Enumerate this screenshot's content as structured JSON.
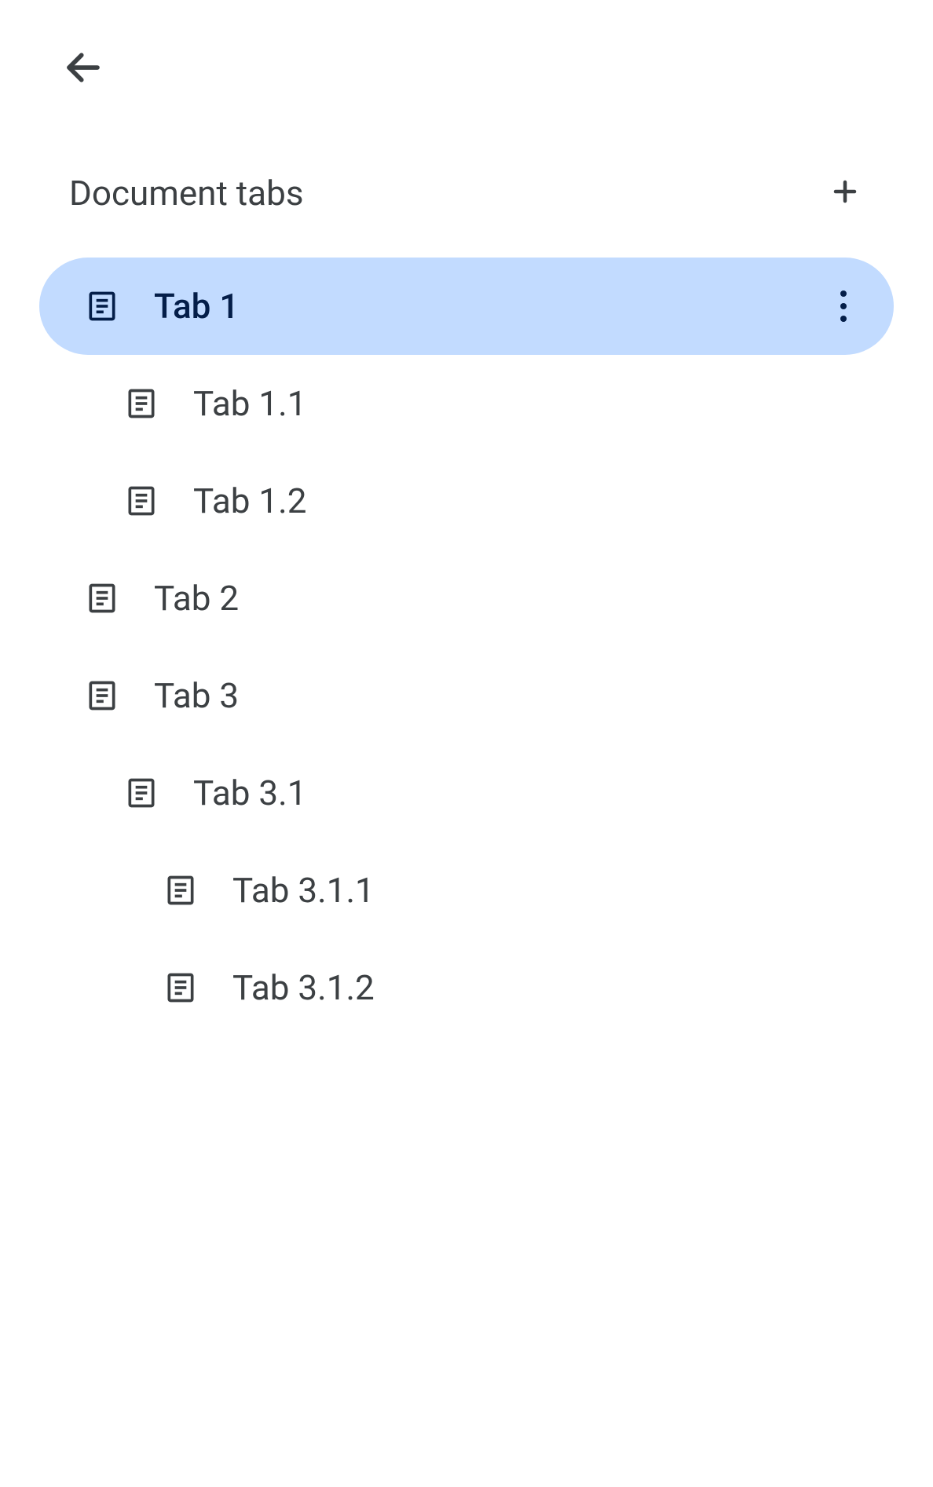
{
  "header": {
    "title": "Document tabs"
  },
  "tabs": [
    {
      "label": "Tab 1",
      "level": 0,
      "selected": true
    },
    {
      "label": "Tab 1.1",
      "level": 1,
      "selected": false
    },
    {
      "label": "Tab 1.2",
      "level": 1,
      "selected": false
    },
    {
      "label": "Tab 2",
      "level": 0,
      "selected": false
    },
    {
      "label": "Tab 3",
      "level": 0,
      "selected": false
    },
    {
      "label": "Tab 3.1",
      "level": 1,
      "selected": false
    },
    {
      "label": "Tab 3.1.1",
      "level": 2,
      "selected": false
    },
    {
      "label": "Tab 3.1.2",
      "level": 2,
      "selected": false
    }
  ]
}
